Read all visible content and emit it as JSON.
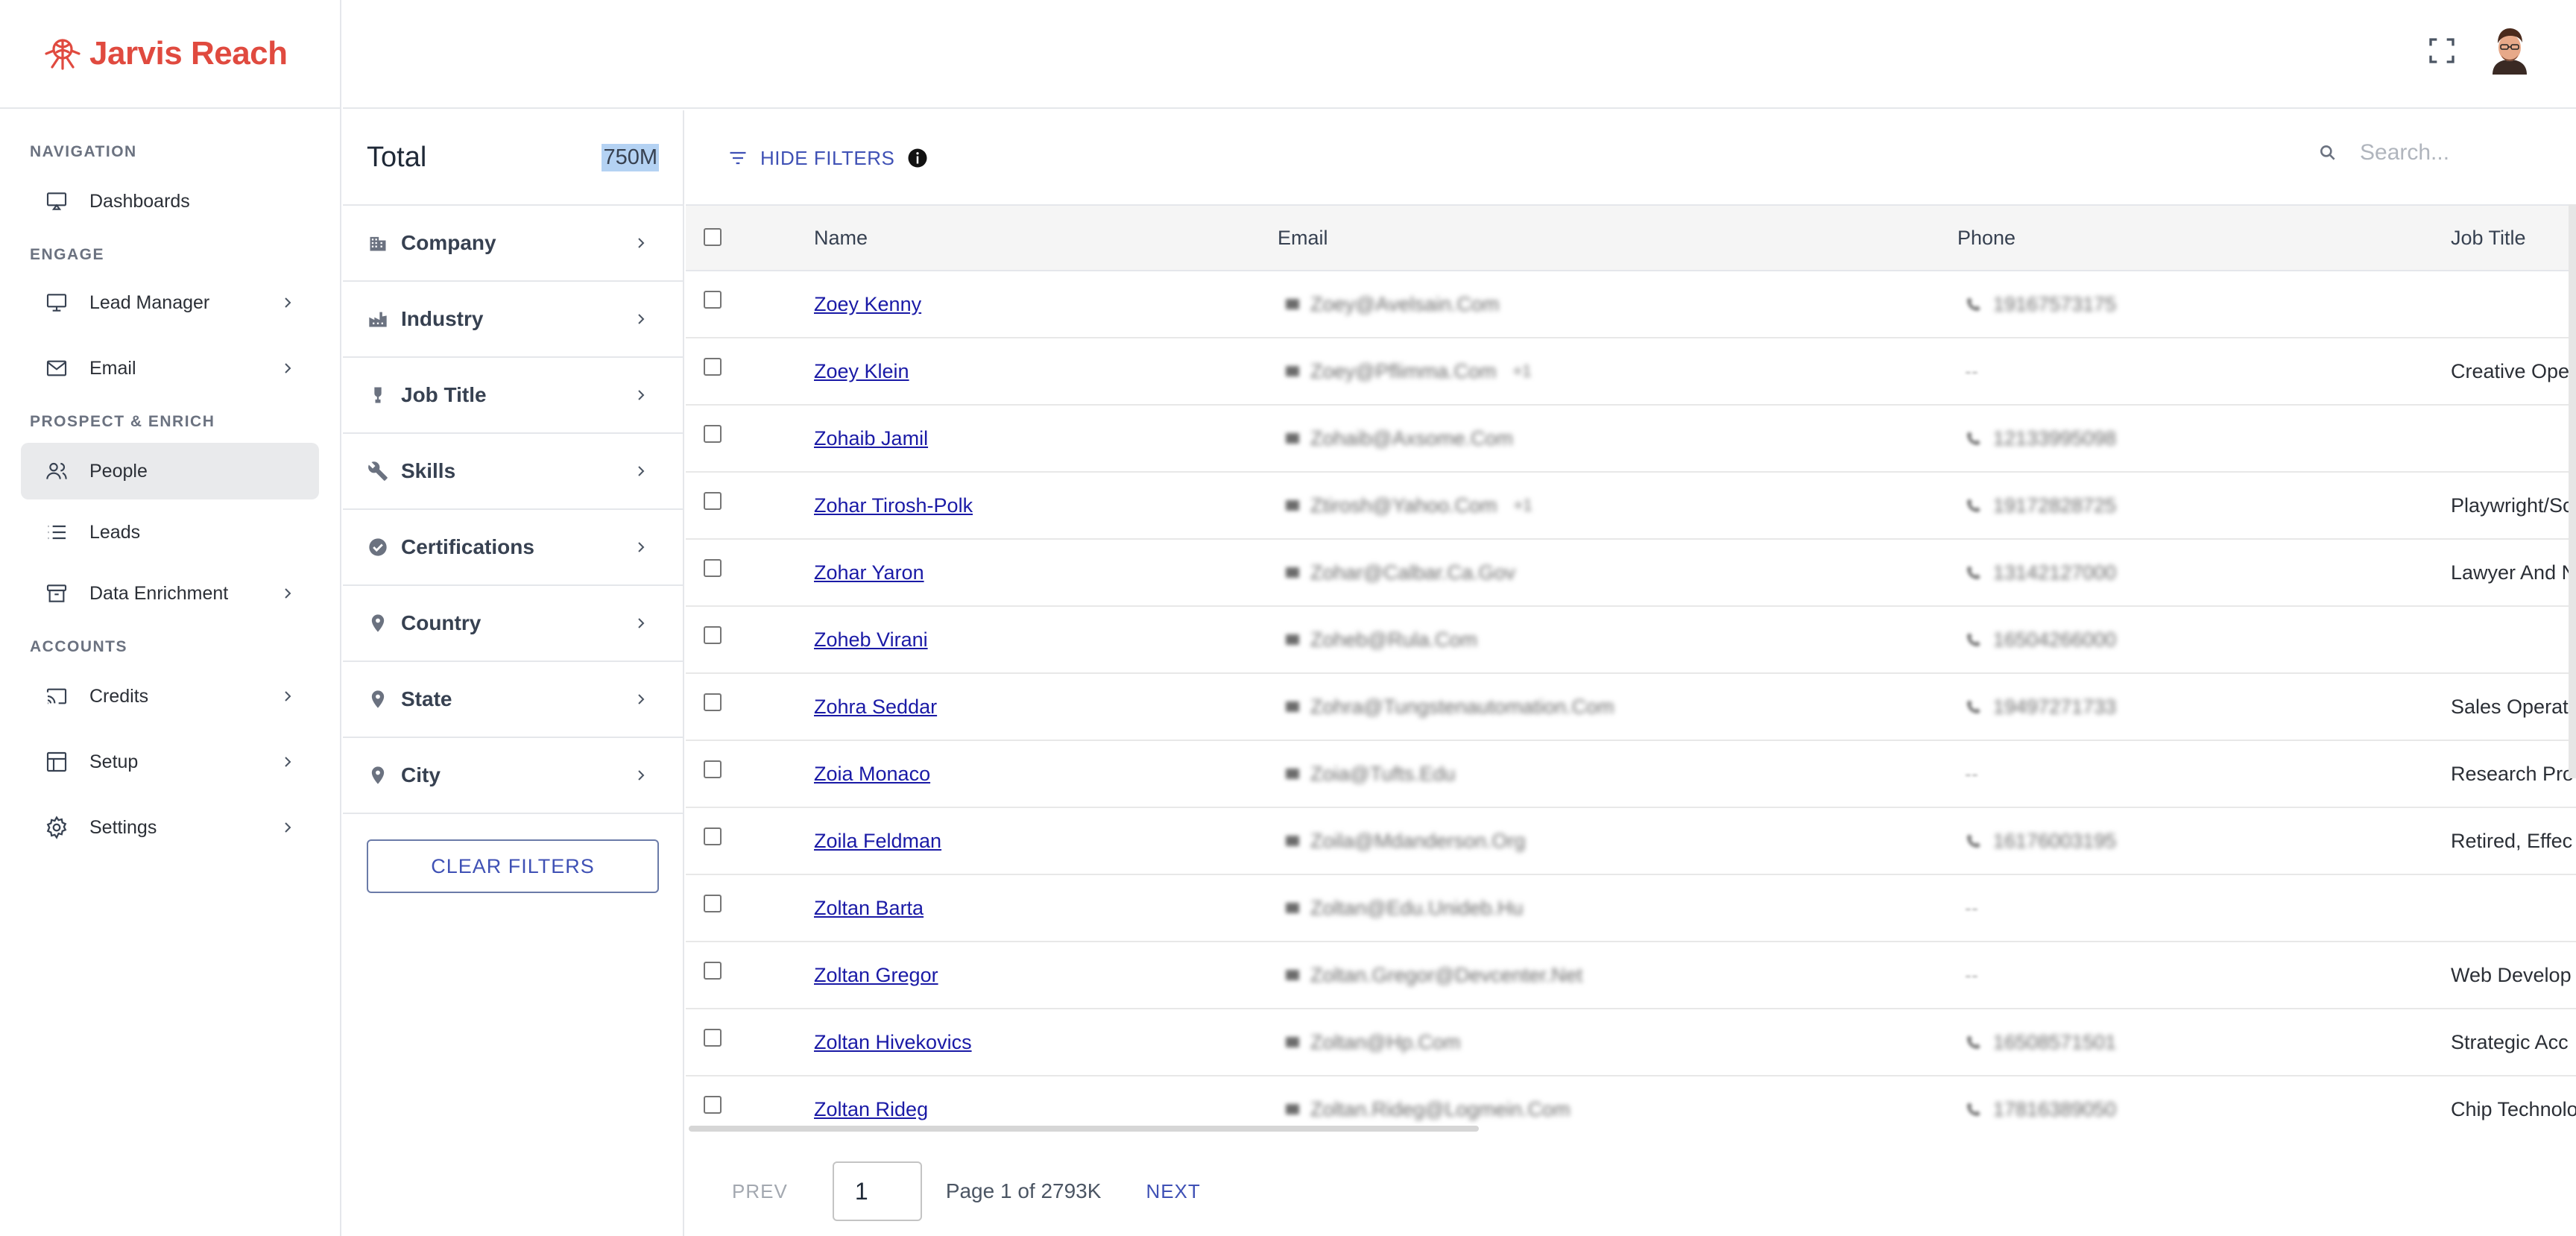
{
  "app": {
    "name": "Jarvis Reach",
    "brand_color": "#e04a3f",
    "accent_color": "#3f51b5"
  },
  "sidebar": {
    "sections": [
      {
        "title": "NAVIGATION",
        "items": [
          {
            "label": "Dashboards",
            "icon": "dashboard-icon",
            "has_chevron": false
          }
        ]
      },
      {
        "title": "ENGAGE",
        "items": [
          {
            "label": "Lead Manager",
            "icon": "monitor-icon",
            "has_chevron": true
          },
          {
            "label": "Email",
            "icon": "mail-icon",
            "has_chevron": true
          }
        ]
      },
      {
        "title": "PROSPECT & ENRICH",
        "items": [
          {
            "label": "People",
            "icon": "people-icon",
            "has_chevron": false,
            "active": true
          },
          {
            "label": "Leads",
            "icon": "list-icon",
            "has_chevron": false
          },
          {
            "label": "Data Enrichment",
            "icon": "archive-icon",
            "has_chevron": true
          }
        ]
      },
      {
        "title": "ACCOUNTS",
        "items": [
          {
            "label": "Credits",
            "icon": "cast-icon",
            "has_chevron": true
          },
          {
            "label": "Setup",
            "icon": "layout-icon",
            "has_chevron": true
          },
          {
            "label": "Settings",
            "icon": "gear-icon",
            "has_chevron": true
          }
        ]
      }
    ]
  },
  "filters": {
    "total_label": "Total",
    "total_value": "750M",
    "items": [
      {
        "label": "Company",
        "icon": "building-icon"
      },
      {
        "label": "Industry",
        "icon": "factory-icon"
      },
      {
        "label": "Job Title",
        "icon": "trophy-icon"
      },
      {
        "label": "Skills",
        "icon": "wrench-icon"
      },
      {
        "label": "Certifications",
        "icon": "verified-icon"
      },
      {
        "label": "Country",
        "icon": "location-pin-icon"
      },
      {
        "label": "State",
        "icon": "location-pin-icon"
      },
      {
        "label": "City",
        "icon": "location-pin-icon"
      }
    ],
    "clear_label": "CLEAR FILTERS"
  },
  "toolbar": {
    "hide_filters_label": "HIDE FILTERS",
    "search_placeholder": "Search..."
  },
  "table": {
    "columns": [
      "Name",
      "Email",
      "Phone",
      "Job Title"
    ],
    "rows": [
      {
        "name": "Zoey Kenny",
        "email": "Zoey@Avelsain.Com",
        "email_extra": "",
        "phone": "19167573175",
        "job": ""
      },
      {
        "name": "Zoey Klein",
        "email": "Zoey@Pflimma.Com",
        "email_extra": "+1",
        "phone": "--",
        "job": "Creative Oper"
      },
      {
        "name": "Zohaib Jamil",
        "email": "Zohaib@Axsome.Com",
        "email_extra": "",
        "phone": "12133995098",
        "job": ""
      },
      {
        "name": "Zohar Tirosh-Polk",
        "email": "Ztirosh@Yahoo.Com",
        "email_extra": "+1",
        "phone": "19172828725",
        "job": "Playwright/Sc"
      },
      {
        "name": "Zohar Yaron",
        "email": "Zohar@Calbar.Ca.Gov",
        "email_extra": "",
        "phone": "13142127000",
        "job": "Lawyer And N"
      },
      {
        "name": "Zoheb Virani",
        "email": "Zoheb@Rula.Com",
        "email_extra": "",
        "phone": "16504266000",
        "job": ""
      },
      {
        "name": "Zohra Seddar",
        "email": "Zohra@Tungstenautomation.Com",
        "email_extra": "",
        "phone": "19497271733",
        "job": "Sales Operati"
      },
      {
        "name": "Zoia Monaco",
        "email": "Zoia@Tufts.Edu",
        "email_extra": "",
        "phone": "--",
        "job": "Research Pro"
      },
      {
        "name": "Zoila Feldman",
        "email": "Zoila@Mdanderson.Org",
        "email_extra": "",
        "phone": "16176003195",
        "job": "Retired, Effec"
      },
      {
        "name": "Zoltan Barta",
        "email": "Zoltan@Edu.Unideb.Hu",
        "email_extra": "",
        "phone": "--",
        "job": ""
      },
      {
        "name": "Zoltan Gregor",
        "email": "Zoltan.Gregor@Devcenter.Net",
        "email_extra": "",
        "phone": "--",
        "job": "Web Develop"
      },
      {
        "name": "Zoltan Hivekovics",
        "email": "Zoltan@Hp.Com",
        "email_extra": "",
        "phone": "16508571501",
        "job": "Strategic Acc"
      },
      {
        "name": "Zoltan Rideg",
        "email": "Zoltan.Rideg@Logmein.Com",
        "email_extra": "",
        "phone": "17816389050",
        "job": "Chip Technolo"
      }
    ]
  },
  "pagination": {
    "prev_label": "PREV",
    "current_page": "1",
    "page_info": "Page 1 of 2793K",
    "next_label": "NEXT"
  }
}
